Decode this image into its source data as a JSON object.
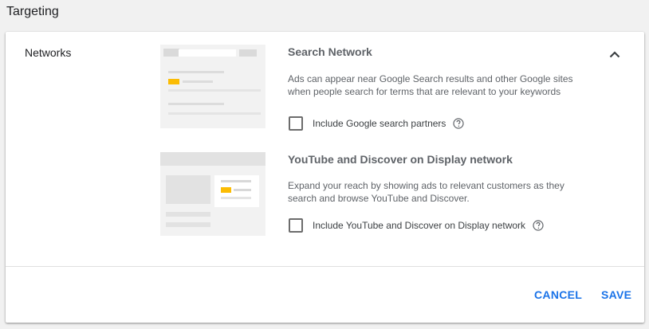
{
  "section_title": "Targeting",
  "networks_label": "Networks",
  "search_network": {
    "title": "Search Network",
    "description": "Ads can appear near Google Search results and other Google sites when people search for terms that are relevant to your keywords",
    "checkbox_label": "Include Google search partners",
    "checked": false
  },
  "display_network": {
    "title": "YouTube and Discover on Display network",
    "description": "Expand your reach by showing ads to relevant customers as they search and browse YouTube and Discover.",
    "checkbox_label": "Include YouTube and Discover on Display network",
    "checked": false
  },
  "actions": {
    "cancel": "CANCEL",
    "save": "SAVE"
  },
  "colors": {
    "accent": "#1a73e8",
    "ad_highlight": "#fbbc04"
  },
  "icons": {
    "collapse": "chevron-up-icon",
    "help": "help-circle-icon"
  }
}
